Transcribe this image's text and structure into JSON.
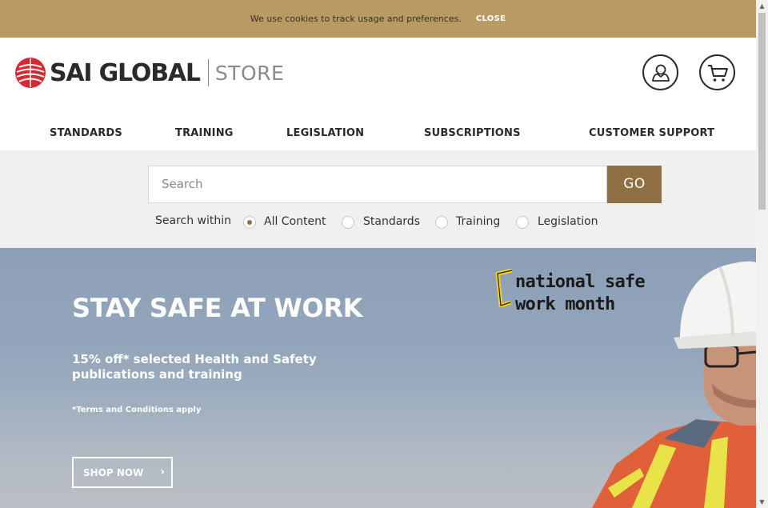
{
  "cookie_bar": {
    "message": "We use cookies to track usage and preferences.",
    "close_label": "CLOSE"
  },
  "header": {
    "logo_name": "SAI GLOBAL",
    "logo_store": "STORE",
    "user_icon": "user-icon",
    "cart_icon": "cart-icon",
    "nav": [
      {
        "label": "STANDARDS"
      },
      {
        "label": "TRAINING"
      },
      {
        "label": "LEGISLATION"
      },
      {
        "label": "SUBSCRIPTIONS"
      },
      {
        "label": "CUSTOMER SUPPORT"
      }
    ]
  },
  "search": {
    "placeholder": "Search",
    "go_label": "GO",
    "within_label": "Search within",
    "options": [
      {
        "label": "All Content",
        "checked": true
      },
      {
        "label": "Standards",
        "checked": false
      },
      {
        "label": "Training",
        "checked": false
      },
      {
        "label": "Legislation",
        "checked": false
      }
    ]
  },
  "hero": {
    "title": "STAY SAFE AT WORK",
    "subtitle": "15% off* selected Health and Safety publications and training",
    "terms": "*Terms and Conditions apply",
    "cta_label": "SHOP NOW",
    "badge_line1": "national safe",
    "badge_line2": "work month"
  },
  "colors": {
    "cookie_bar": "#b89a62",
    "accent": "#8f7044",
    "logo_red": "#d7282f",
    "badge_yellow": "#f2d51a"
  }
}
